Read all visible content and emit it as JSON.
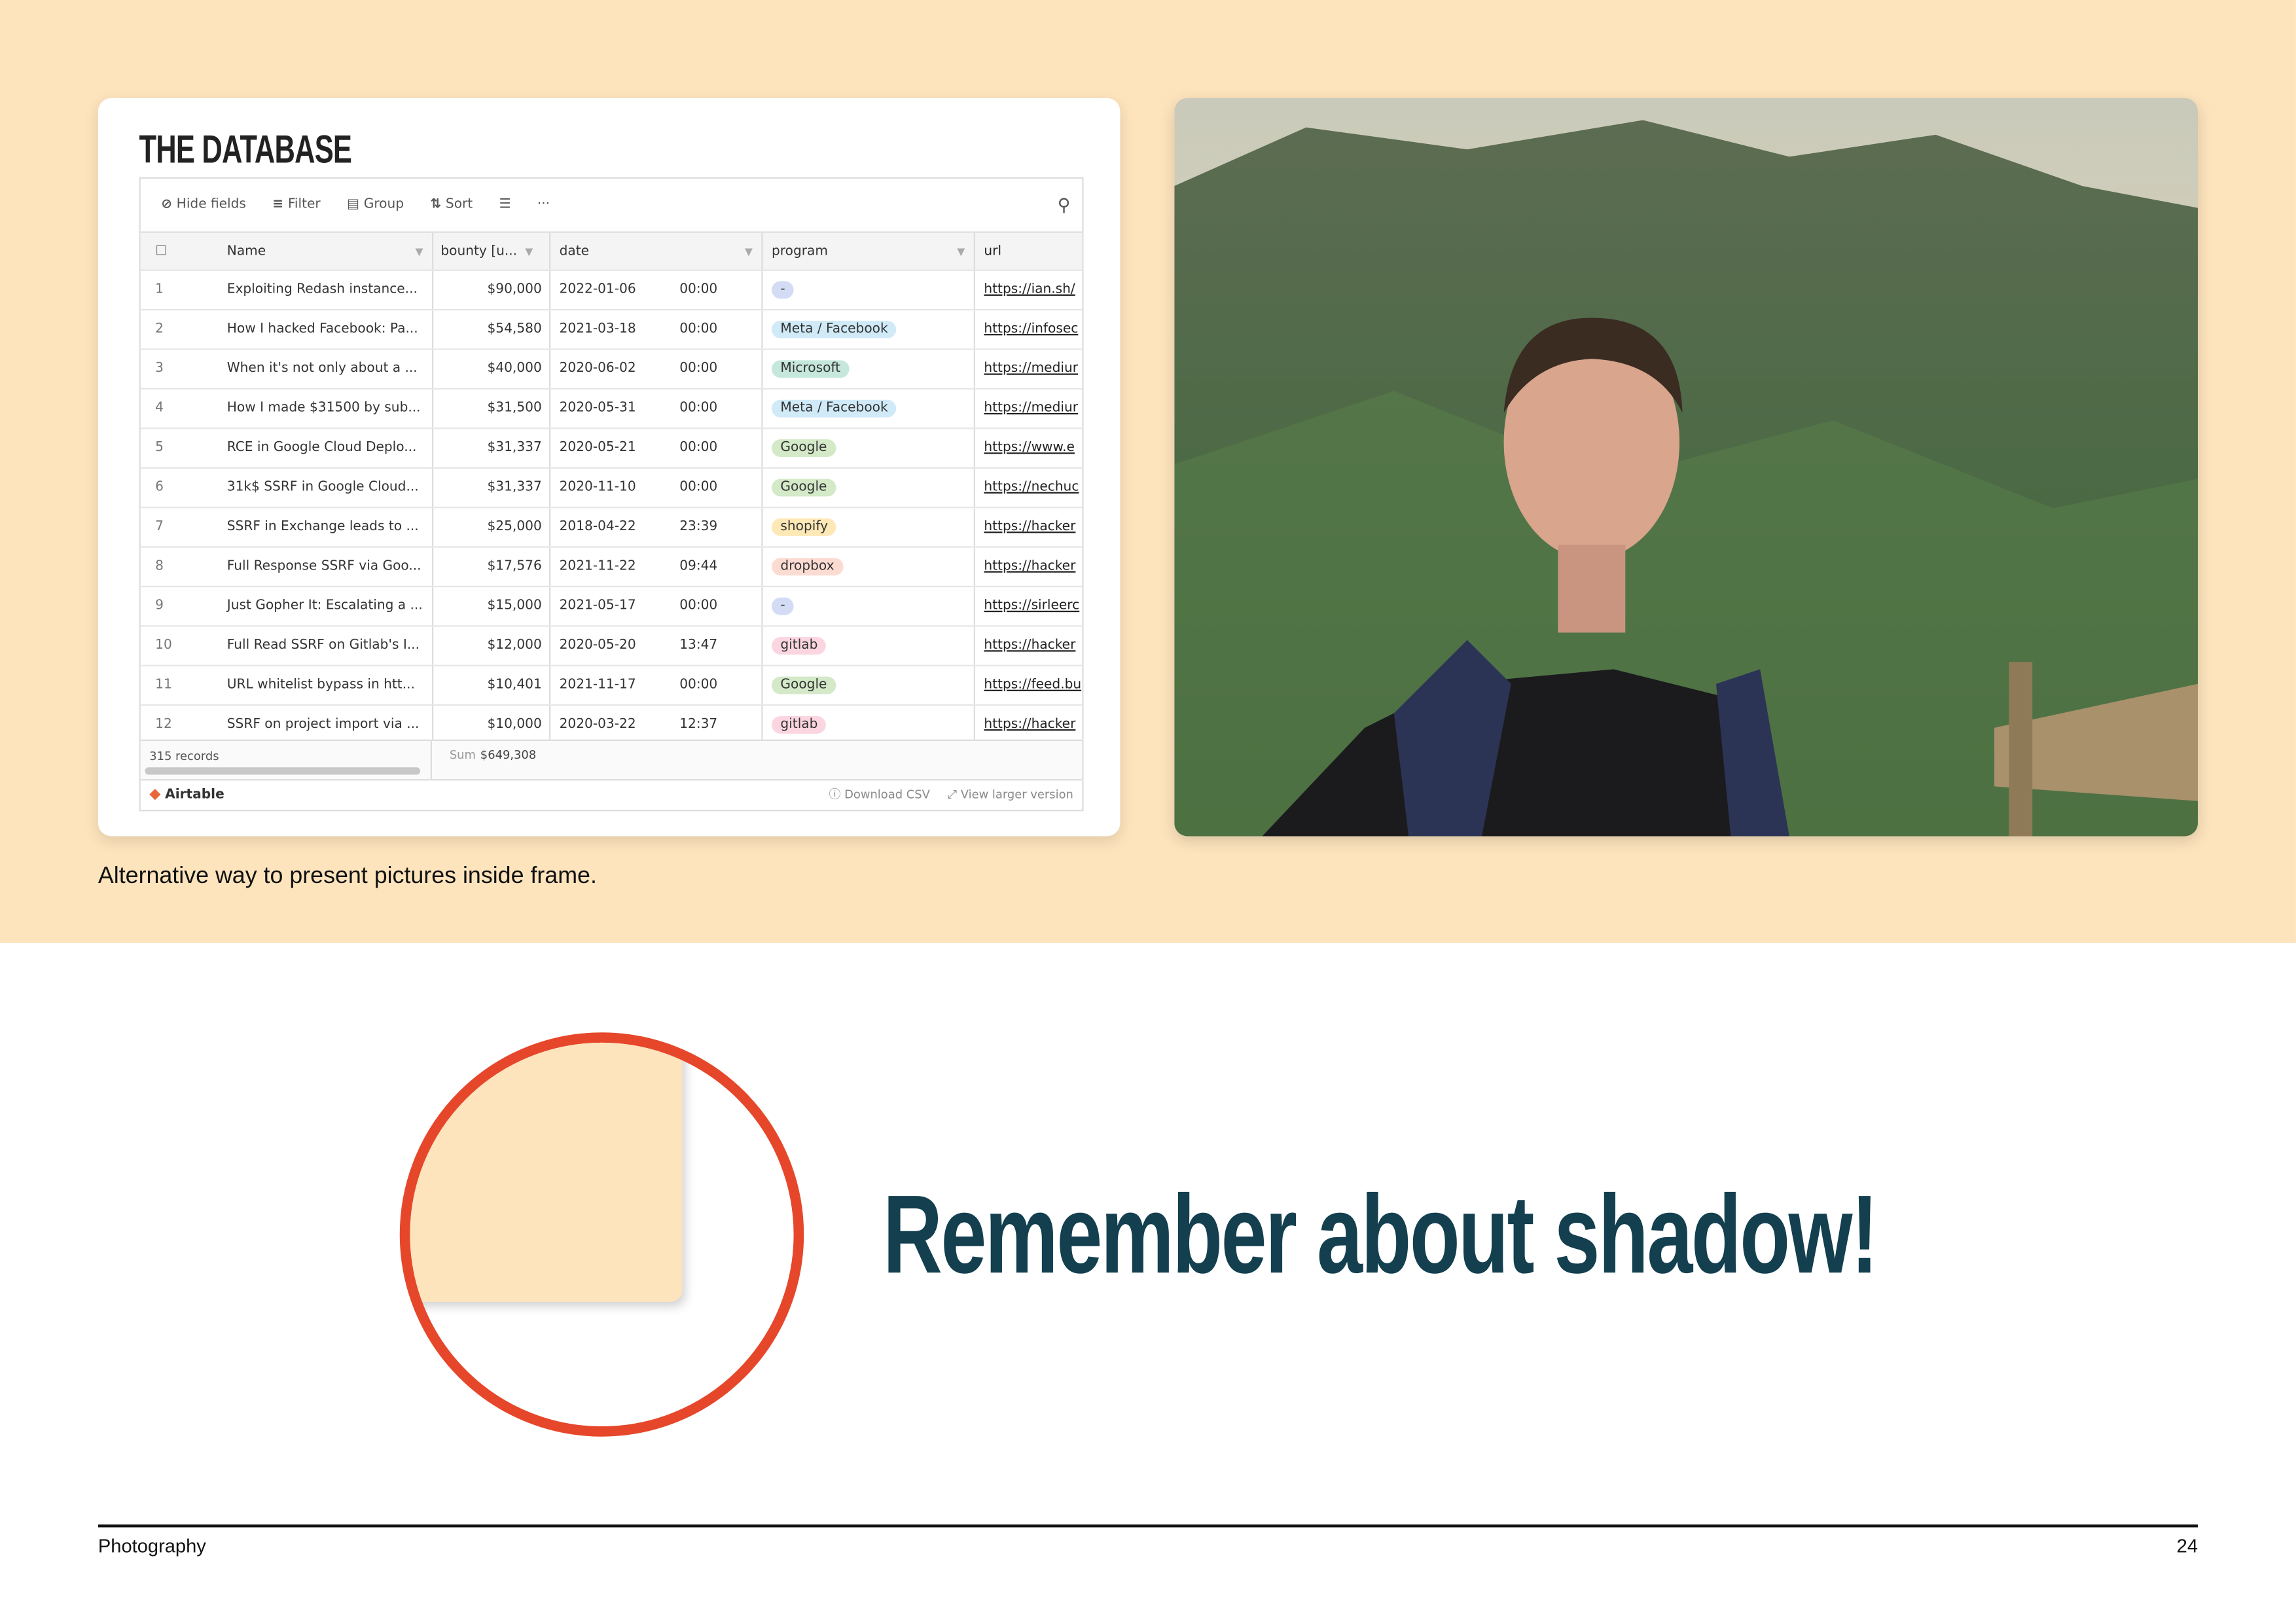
{
  "database_card": {
    "title": "THE DATABASE",
    "toolbar": {
      "hide_fields": "Hide fields",
      "filter": "Filter",
      "group": "Group",
      "sort": "Sort",
      "more": "···"
    },
    "columns": [
      "Name",
      "bounty [u...",
      "date",
      "program",
      "url"
    ],
    "rows": [
      {
        "n": "1",
        "name": "Exploiting Redash instance...",
        "bounty": "$90,000",
        "date": "2022-01-06",
        "time": "00:00",
        "program": "-",
        "color": "#d3dcf4",
        "url": "https://ian.sh/"
      },
      {
        "n": "2",
        "name": "How I hacked Facebook: Pa...",
        "bounty": "$54,580",
        "date": "2021-03-18",
        "time": "00:00",
        "program": "Meta / Facebook",
        "color": "#d0eaf8",
        "url": "https://infosec"
      },
      {
        "n": "3",
        "name": "When it's not only about a ...",
        "bounty": "$40,000",
        "date": "2020-06-02",
        "time": "00:00",
        "program": "Microsoft",
        "color": "#c5e7dc",
        "url": "https://mediur"
      },
      {
        "n": "4",
        "name": "How I made $31500 by sub...",
        "bounty": "$31,500",
        "date": "2020-05-31",
        "time": "00:00",
        "program": "Meta / Facebook",
        "color": "#d0eaf8",
        "url": "https://mediur"
      },
      {
        "n": "5",
        "name": "RCE in Google Cloud Deplo...",
        "bounty": "$31,337",
        "date": "2020-05-21",
        "time": "00:00",
        "program": "Google",
        "color": "#d3e9c8",
        "url": "https://www.e"
      },
      {
        "n": "6",
        "name": "31k$ SSRF in Google Cloud...",
        "bounty": "$31,337",
        "date": "2020-11-10",
        "time": "00:00",
        "program": "Google",
        "color": "#d3e9c8",
        "url": "https://nechuc"
      },
      {
        "n": "7",
        "name": "SSRF in Exchange leads to ...",
        "bounty": "$25,000",
        "date": "2018-04-22",
        "time": "23:39",
        "program": "shopify",
        "color": "#fde8b6",
        "url": "https://hacker"
      },
      {
        "n": "8",
        "name": "Full Response SSRF via Goo...",
        "bounty": "$17,576",
        "date": "2021-11-22",
        "time": "09:44",
        "program": "dropbox",
        "color": "#fcdcd2",
        "url": "https://hacker"
      },
      {
        "n": "9",
        "name": "Just Gopher It: Escalating a ...",
        "bounty": "$15,000",
        "date": "2021-05-17",
        "time": "00:00",
        "program": "-",
        "color": "#d3dcf4",
        "url": "https://sirleerc"
      },
      {
        "n": "10",
        "name": "Full Read SSRF on Gitlab's I...",
        "bounty": "$12,000",
        "date": "2020-05-20",
        "time": "13:47",
        "program": "gitlab",
        "color": "#fbd6e1",
        "url": "https://hacker"
      },
      {
        "n": "11",
        "name": "URL whitelist bypass in htt...",
        "bounty": "$10,401",
        "date": "2021-11-17",
        "time": "00:00",
        "program": "Google",
        "color": "#d3e9c8",
        "url": "https://feed.bu"
      },
      {
        "n": "12",
        "name": "SSRF on project import via ...",
        "bounty": "$10,000",
        "date": "2020-03-22",
        "time": "12:37",
        "program": "gitlab",
        "color": "#fbd6e1",
        "url": "https://hacker"
      }
    ],
    "records": "315 records",
    "sum_label": "Sum",
    "sum_value": "$649,308",
    "brand": "Airtable",
    "download": "Download CSV",
    "view_larger": "View larger version"
  },
  "caption": "Alternative way to present pictures inside frame.",
  "headline": "Remember about shadow!",
  "footer": {
    "section": "Photography",
    "page": "24"
  },
  "colors": {
    "band": "#fde4bd",
    "accent_circle": "#e6472b",
    "headline": "#133f4f"
  }
}
